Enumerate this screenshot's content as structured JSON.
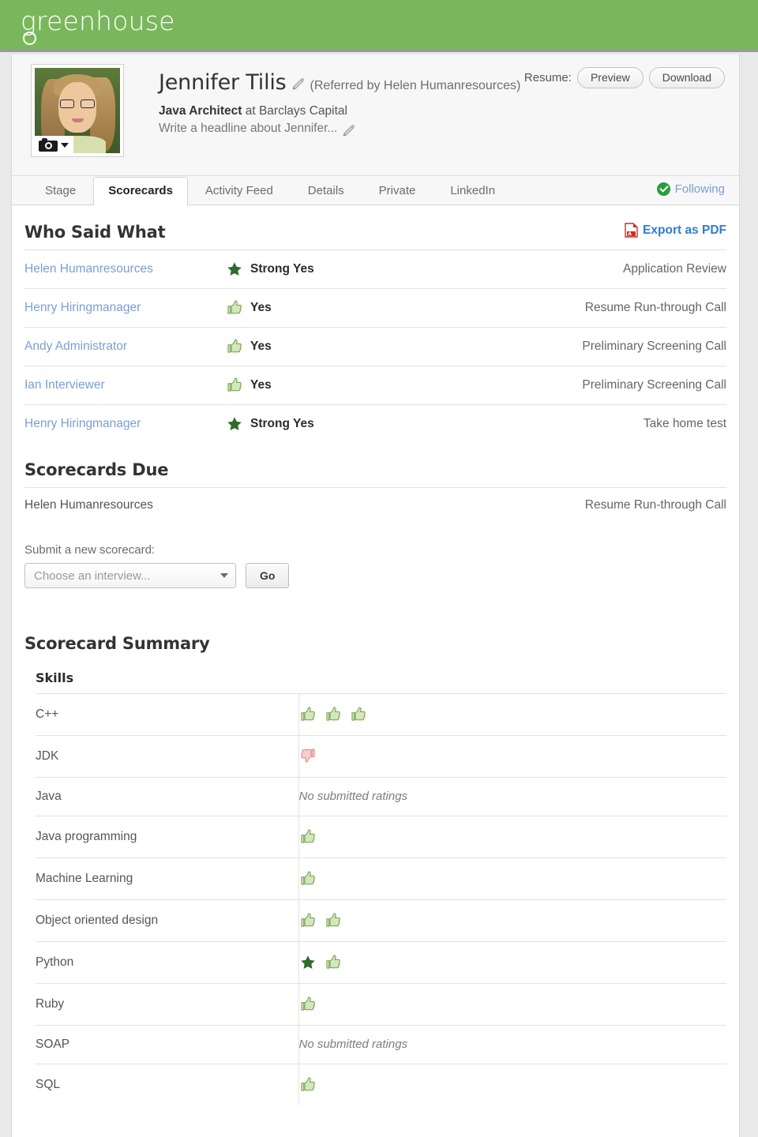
{
  "brand": {
    "logo_text": "greenhouse",
    "header_color": "#7ab75c"
  },
  "candidate": {
    "name": "Jennifer Tilis",
    "referred_by": "(Referred by Helen Humanresources)",
    "title": "Java Architect",
    "company_prefix": " at ",
    "company": "Barclays Capital",
    "headline_placeholder": "Write a headline about Jennifer...",
    "edit_name_icon": "pencil-icon",
    "edit_headline_icon": "pencil-icon",
    "avatar_icon": "camera-icon"
  },
  "resume": {
    "label": "Resume:",
    "preview_label": "Preview",
    "download_label": "Download"
  },
  "tabs": [
    {
      "label": "Stage",
      "active": false
    },
    {
      "label": "Scorecards",
      "active": true
    },
    {
      "label": "Activity Feed",
      "active": false
    },
    {
      "label": "Details",
      "active": false
    },
    {
      "label": "Private",
      "active": false
    },
    {
      "label": "LinkedIn",
      "active": false
    }
  ],
  "follow": {
    "label": "Following",
    "icon": "check-circle-icon",
    "color": "#2d9c3c"
  },
  "who_said_what": {
    "title": "Who Said What",
    "export_label": "Export as PDF",
    "export_icon": "pdf-icon",
    "rows": [
      {
        "person": "Helen Humanresources",
        "verdict": "Strong Yes",
        "icon": "star-icon",
        "stage": "Application Review"
      },
      {
        "person": "Henry Hiringmanager",
        "verdict": "Yes",
        "icon": "thumbs-up-icon",
        "stage": "Resume Run-through Call"
      },
      {
        "person": "Andy Administrator",
        "verdict": "Yes",
        "icon": "thumbs-up-icon",
        "stage": "Preliminary Screening Call"
      },
      {
        "person": "Ian Interviewer",
        "verdict": "Yes",
        "icon": "thumbs-up-icon",
        "stage": "Preliminary Screening Call"
      },
      {
        "person": "Henry Hiringmanager",
        "verdict": "Strong Yes",
        "icon": "star-icon",
        "stage": "Take home test"
      }
    ]
  },
  "scorecards_due": {
    "title": "Scorecards Due",
    "rows": [
      {
        "person": "Helen Humanresources",
        "stage": "Resume Run-through Call"
      }
    ],
    "submit_label": "Submit a new scorecard:",
    "select_placeholder": "Choose an interview...",
    "go_label": "Go"
  },
  "scorecard_summary": {
    "title": "Scorecard Summary",
    "skills_header": "Skills",
    "no_ratings_text": "No submitted ratings",
    "rows": [
      {
        "skill": "C++",
        "ratings": [
          "thumbs-up-icon",
          "thumbs-up-icon",
          "thumbs-up-icon"
        ]
      },
      {
        "skill": "JDK",
        "ratings": [
          "thumbs-down-icon"
        ]
      },
      {
        "skill": "Java",
        "ratings": []
      },
      {
        "skill": "Java programming",
        "ratings": [
          "thumbs-up-icon"
        ]
      },
      {
        "skill": "Machine Learning",
        "ratings": [
          "thumbs-up-icon"
        ]
      },
      {
        "skill": "Object oriented design",
        "ratings": [
          "thumbs-up-icon",
          "thumbs-up-icon"
        ]
      },
      {
        "skill": "Python",
        "ratings": [
          "star-icon",
          "thumbs-up-icon"
        ]
      },
      {
        "skill": "Ruby",
        "ratings": [
          "thumbs-up-icon"
        ]
      },
      {
        "skill": "SOAP",
        "ratings": []
      },
      {
        "skill": "SQL",
        "ratings": [
          "thumbs-up-icon"
        ]
      }
    ]
  },
  "colors": {
    "thumb_fill": "#d3e7bd",
    "thumb_stroke": "#6f9e4a",
    "thumb_down_fill": "#f7cfcc",
    "thumb_down_stroke": "#e28a82",
    "star": "#2f6b2a",
    "link": "#7b9ed4",
    "export_link": "#2f7dd1"
  }
}
